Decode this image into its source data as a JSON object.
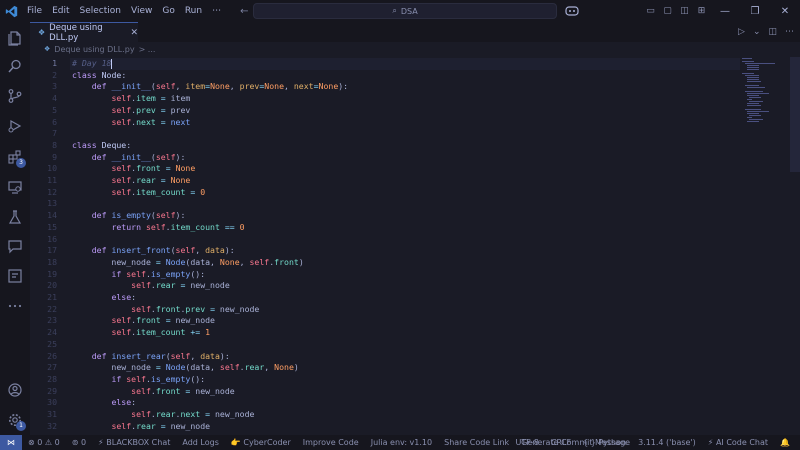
{
  "menu": [
    "File",
    "Edit",
    "Selection",
    "View",
    "Go",
    "Run",
    "⋯"
  ],
  "search": {
    "text": "DSA"
  },
  "tab": {
    "label": "Deque using DLL.py",
    "icon": "python-file-icon"
  },
  "breadcrumb": {
    "file": "Deque using DLL.py",
    "sep": "> ..."
  },
  "activity_badges": {
    "extensions": "3",
    "accounts": "1"
  },
  "code_lines": [
    {
      "n": "1"
    },
    {
      "n": "2"
    },
    {
      "n": "3"
    },
    {
      "n": "4"
    },
    {
      "n": "5"
    },
    {
      "n": "6"
    },
    {
      "n": "7"
    },
    {
      "n": "8"
    },
    {
      "n": "9"
    },
    {
      "n": "10"
    },
    {
      "n": "11"
    },
    {
      "n": "12"
    },
    {
      "n": "13"
    },
    {
      "n": "14"
    },
    {
      "n": "15"
    },
    {
      "n": "16"
    },
    {
      "n": "17"
    },
    {
      "n": "18"
    },
    {
      "n": "19"
    },
    {
      "n": "20"
    },
    {
      "n": "21"
    },
    {
      "n": "22"
    },
    {
      "n": "23"
    },
    {
      "n": "24"
    },
    {
      "n": "25"
    },
    {
      "n": "26"
    },
    {
      "n": "27"
    },
    {
      "n": "28"
    },
    {
      "n": "29"
    },
    {
      "n": "30"
    },
    {
      "n": "31"
    },
    {
      "n": "32"
    }
  ],
  "status": {
    "errors": "0",
    "warnings": "0",
    "ports": "0",
    "blackbox": "BLACKBOX Chat",
    "add_logs": "Add Logs",
    "cybercoder": "CyberCoder",
    "improve": "Improve Code",
    "julia": "Julia env: v1.10",
    "share": "Share Code Link",
    "commit": "Generate Commit Message",
    "encoding": "UTF-8",
    "eol": "CRLF",
    "language": "Python",
    "interpreter": "3.11.4 ('base')",
    "ai_chat": "AI Code Chat"
  },
  "colors": {
    "accent": "#3d59a1",
    "background": "#1a1b26",
    "keyword": "#bb9af7",
    "function": "#7aa2f7",
    "self": "#f7768e"
  }
}
